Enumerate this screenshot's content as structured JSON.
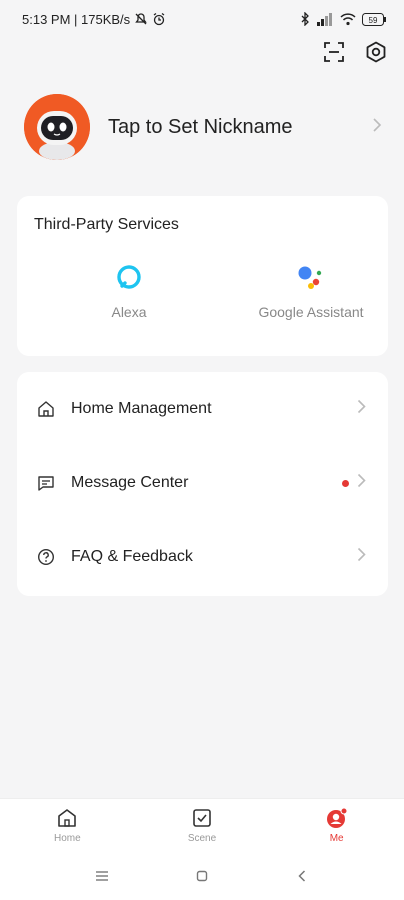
{
  "status_bar": {
    "time_speed": "5:13 PM | 175KB/s",
    "battery": "59"
  },
  "profile": {
    "nickname": "Tap to Set Nickname"
  },
  "services": {
    "title": "Third-Party Services",
    "items": [
      {
        "label": "Alexa",
        "icon": "alexa-icon"
      },
      {
        "label": "Google Assistant",
        "icon": "google-assistant-icon"
      }
    ]
  },
  "menu": {
    "items": [
      {
        "label": "Home Management",
        "icon": "home-icon"
      },
      {
        "label": "Message Center",
        "icon": "message-icon",
        "badge": "unread-dot"
      },
      {
        "label": "FAQ & Feedback",
        "icon": "question-icon"
      }
    ]
  },
  "bottom_nav": {
    "tabs": [
      {
        "label": "Home",
        "icon": "home-icon"
      },
      {
        "label": "Scene",
        "icon": "scene-check-icon"
      },
      {
        "label": "Me",
        "icon": "me-icon",
        "active": true
      }
    ]
  },
  "colors": {
    "accent": "#e53935",
    "avatar_bg": "#f05a24",
    "alexa": "#1ec4f0",
    "google_blue": "#4285f4",
    "google_red": "#ea4335",
    "google_yellow": "#fbbc05",
    "google_green": "#34a853"
  }
}
